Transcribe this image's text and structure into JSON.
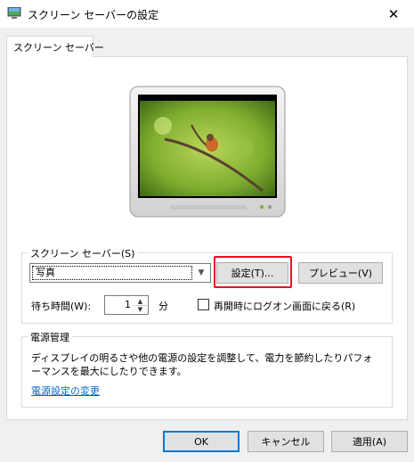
{
  "window": {
    "title": "スクリーン セーバーの設定",
    "close_glyph": "✕"
  },
  "tabs": [
    {
      "label": "スクリーン セーバー",
      "selected": true
    }
  ],
  "screensaver": {
    "group_label": "スクリーン セーバー(S)",
    "selected_value": "写真",
    "settings_button": "設定(T)...",
    "preview_button": "プレビュー(V)",
    "wait_label": "待ち時間(W):",
    "wait_value": "1",
    "wait_unit": "分",
    "resume_label": "再開時にログオン画面に戻る(R)",
    "resume_checked": false
  },
  "power": {
    "group_label": "電源管理",
    "description_line1": "ディスプレイの明るさや他の電源の設定を調整して、電力を節約したりパフォ",
    "description_line2": "ーマンスを最大にしたりできます。",
    "link": "電源設定の変更"
  },
  "footer": {
    "ok": "OK",
    "cancel": "キャンセル",
    "apply": "適用(A)"
  },
  "colors": {
    "highlight": "#e81123",
    "link": "#0066cc",
    "default_button_border": "#0078d7"
  }
}
